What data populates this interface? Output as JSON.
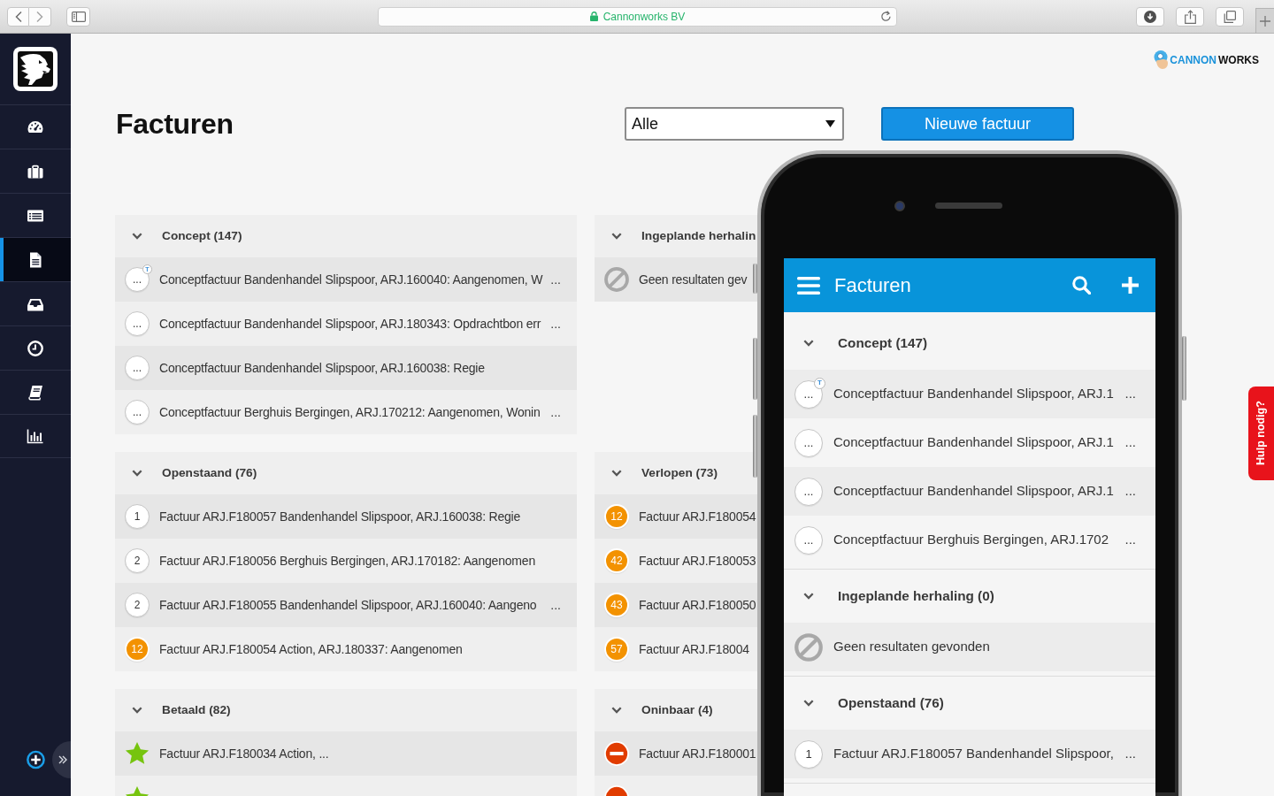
{
  "browser": {
    "address": "Cannonworks BV"
  },
  "sidebar": {
    "items": [
      {
        "kind": "gauge",
        "selected": false
      },
      {
        "kind": "briefcase",
        "selected": false
      },
      {
        "kind": "list",
        "selected": false
      },
      {
        "kind": "document",
        "selected": true
      },
      {
        "kind": "inbox",
        "selected": false
      },
      {
        "kind": "clock",
        "selected": false
      },
      {
        "kind": "book",
        "selected": false
      },
      {
        "kind": "chart",
        "selected": false
      }
    ]
  },
  "logo": {
    "words": [
      "CANNON",
      "WORKS"
    ]
  },
  "header": {
    "title": "Facturen",
    "filter": {
      "value": "Alle"
    },
    "new_button": "Nieuwe factuur"
  },
  "columns": [
    {
      "groups": [
        {
          "title": "Concept (147)",
          "expanded": true,
          "rows": [
            {
              "kind": "circle",
              "badge": "...",
              "tag": "T",
              "text": "Conceptfactuur Bandenhandel Slipspoor, ARJ.160040: Aangenomen, W",
              "more": "..."
            },
            {
              "kind": "circle",
              "badge": "...",
              "text": "Conceptfactuur Bandenhandel Slipspoor, ARJ.180343: Opdrachtbon err",
              "more": "..."
            },
            {
              "kind": "circle",
              "badge": "...",
              "text": "Conceptfactuur Bandenhandel Slipspoor, ARJ.160038: Regie"
            },
            {
              "kind": "circle",
              "badge": "...",
              "text": "Conceptfactuur Berghuis Bergingen, ARJ.170212: Aangenomen, Wonin",
              "more": "..."
            }
          ]
        },
        {
          "title": "Openstaand (76)",
          "expanded": true,
          "rows": [
            {
              "kind": "circle",
              "badge": "1",
              "text": "Factuur ARJ.F180057 Bandenhandel Slipspoor, ARJ.160038: Regie"
            },
            {
              "kind": "circle",
              "badge": "2",
              "text": "Factuur ARJ.F180056 Berghuis Bergingen, ARJ.170182: Aangenomen"
            },
            {
              "kind": "circle",
              "badge": "2",
              "text": "Factuur ARJ.F180055 Bandenhandel Slipspoor, ARJ.160040: Aangeno",
              "more": "..."
            },
            {
              "kind": "warning",
              "badge": "12",
              "text": "Factuur ARJ.F180054 Action, ARJ.180337: Aangenomen"
            }
          ]
        },
        {
          "title": "Betaald (82)",
          "expanded": true,
          "rows": [
            {
              "kind": "star",
              "text": "Factuur ARJ.F180034 Action, ..."
            },
            {
              "kind": "star"
            }
          ]
        }
      ]
    },
    {
      "groups": [
        {
          "title": "Ingeplande herhalin",
          "expanded": true,
          "rows": [
            {
              "kind": "none",
              "text": "Geen resultaten gev"
            }
          ]
        },
        {
          "title": "Verlopen (73)",
          "expanded": true,
          "rows": [
            {
              "kind": "warning",
              "badge": "12",
              "text": "Factuur ARJ.F180054"
            },
            {
              "kind": "warning",
              "badge": "42",
              "text": "Factuur ARJ.F180053"
            },
            {
              "kind": "warning",
              "badge": "43",
              "text": "Factuur ARJ.F180050"
            },
            {
              "kind": "warning",
              "badge": "57",
              "text": "Factuur ARJ.F18004"
            }
          ]
        },
        {
          "title": "Oninbaar (4)",
          "expanded": true,
          "rows": [
            {
              "kind": "blocked",
              "text": "Factuur ARJ.F180001"
            },
            {
              "kind": "blocked"
            }
          ]
        }
      ]
    }
  ],
  "phone": {
    "title": "Facturen",
    "groups": [
      {
        "title": "Concept (147)",
        "expanded": true,
        "rows": [
          {
            "kind": "circle",
            "badge": "...",
            "tag": "T",
            "text": "Conceptfactuur Bandenhandel Slipspoor, ARJ.1",
            "more": "..."
          },
          {
            "kind": "circle",
            "badge": "...",
            "text": "Conceptfactuur Bandenhandel Slipspoor, ARJ.1",
            "more": "..."
          },
          {
            "kind": "circle",
            "badge": "...",
            "text": "Conceptfactuur Bandenhandel Slipspoor, ARJ.1",
            "more": "..."
          },
          {
            "kind": "circle",
            "badge": "...",
            "text": "Conceptfactuur Berghuis Bergingen, ARJ.1702",
            "more": "..."
          }
        ]
      },
      {
        "title": "Ingeplande herhaling (0)",
        "expanded": true,
        "rows": [
          {
            "kind": "none",
            "text": "Geen resultaten gevonden"
          }
        ]
      },
      {
        "title": "Openstaand (76)",
        "expanded": true,
        "rows": [
          {
            "kind": "circle",
            "badge": "1",
            "text": "Factuur ARJ.F180057 Bandenhandel Slipspoor,",
            "more": "..."
          }
        ]
      }
    ]
  },
  "help_tab": {
    "label": "Hulp nodig?"
  }
}
